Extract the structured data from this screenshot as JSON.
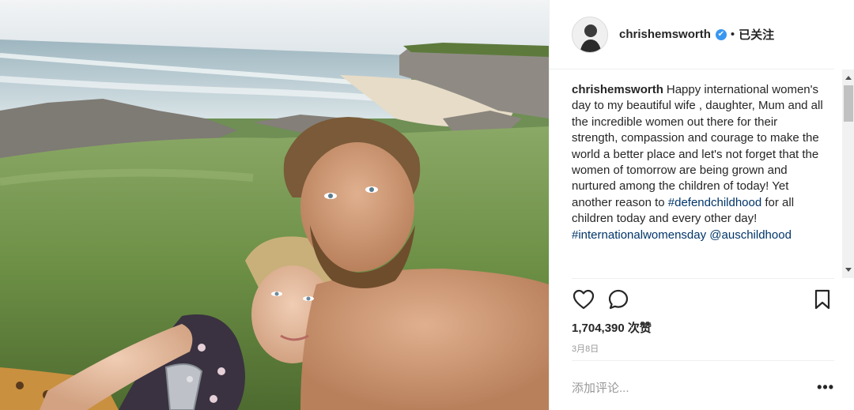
{
  "post": {
    "photo_alt": "Selfie of a man and a woman lying on grass on a cliff above the sea"
  },
  "header": {
    "username": "chrishemsworth",
    "verified_badge": "✔",
    "separator": "•",
    "follow_status": "已关注"
  },
  "caption": {
    "username": "chrishemsworth",
    "text_1": "Happy international women's day to my beautiful wife , daughter, Mum and all the incredible women out there for their strength, compassion and courage to make the world a better place and let's not forget that the women of tomorrow are being grown and nurtured among the children of today! Yet another reason to ",
    "hashtag_1": "#defendchildhood",
    "text_2": " for all children today and every other day! ",
    "hashtag_2": "#internationalwomensday",
    "mention": "@auschildhood"
  },
  "actions": {
    "like_icon": "heart-icon",
    "comment_icon": "comment-icon",
    "save_icon": "bookmark-icon"
  },
  "stats": {
    "likes": "1,704,390 次赞",
    "date": "3月8日"
  },
  "comment": {
    "placeholder": "添加评论...",
    "more_label": "•••"
  },
  "colors": {
    "link": "#003569",
    "verified": "#3897f0",
    "muted": "#999999",
    "text": "#262626"
  }
}
